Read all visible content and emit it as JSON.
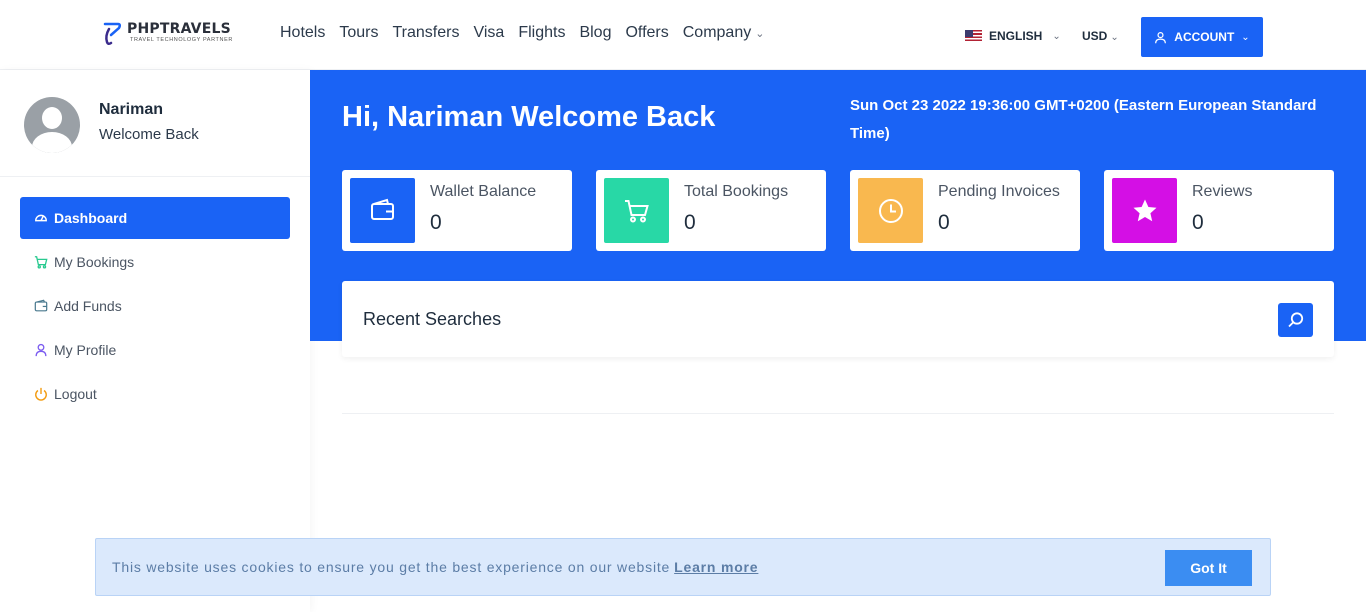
{
  "header": {
    "logo_name": "PHPTRAVELS",
    "logo_tag": "TRAVEL TECHNOLOGY PARTNER",
    "nav": [
      "Hotels",
      "Tours",
      "Transfers",
      "Visa",
      "Flights",
      "Blog",
      "Offers",
      "Company"
    ],
    "language": "ENGLISH",
    "currency": "USD",
    "account_label": "ACCOUNT"
  },
  "sidebar": {
    "user_name": "Nariman",
    "user_subtitle": "Welcome Back",
    "items": [
      {
        "label": "Dashboard",
        "icon": "dashboard-icon",
        "active": true
      },
      {
        "label": "My Bookings",
        "icon": "cart-icon",
        "color": "#28c98f"
      },
      {
        "label": "Add Funds",
        "icon": "wallet-icon",
        "color": "#4b7a8f"
      },
      {
        "label": "My Profile",
        "icon": "user-icon",
        "color": "#7b5cf0"
      },
      {
        "label": "Logout",
        "icon": "power-icon",
        "color": "#f39c12"
      }
    ]
  },
  "main": {
    "greeting": "Hi, Nariman Welcome Back",
    "datetime": "Sun Oct 23 2022 19:36:00 GMT+0200 (Eastern European Standard Time)",
    "cards": [
      {
        "label": "Wallet Balance",
        "value": "0",
        "icon": "wallet-icon",
        "color": "#1a63f5"
      },
      {
        "label": "Total Bookings",
        "value": "0",
        "icon": "cart-icon",
        "color": "#28d8a6"
      },
      {
        "label": "Pending Invoices",
        "value": "0",
        "icon": "clock-icon",
        "color": "#f9b84f"
      },
      {
        "label": "Reviews",
        "value": "0",
        "icon": "star-icon",
        "color": "#d40fe5"
      }
    ],
    "recent_searches_title": "Recent Searches"
  },
  "cookie": {
    "text": "This website uses cookies to ensure you get the best experience on our website",
    "link": "Learn more",
    "button": "Got It"
  },
  "colors": {
    "primary": "#1a63f5",
    "cookie_bg": "#dbe9fc"
  }
}
